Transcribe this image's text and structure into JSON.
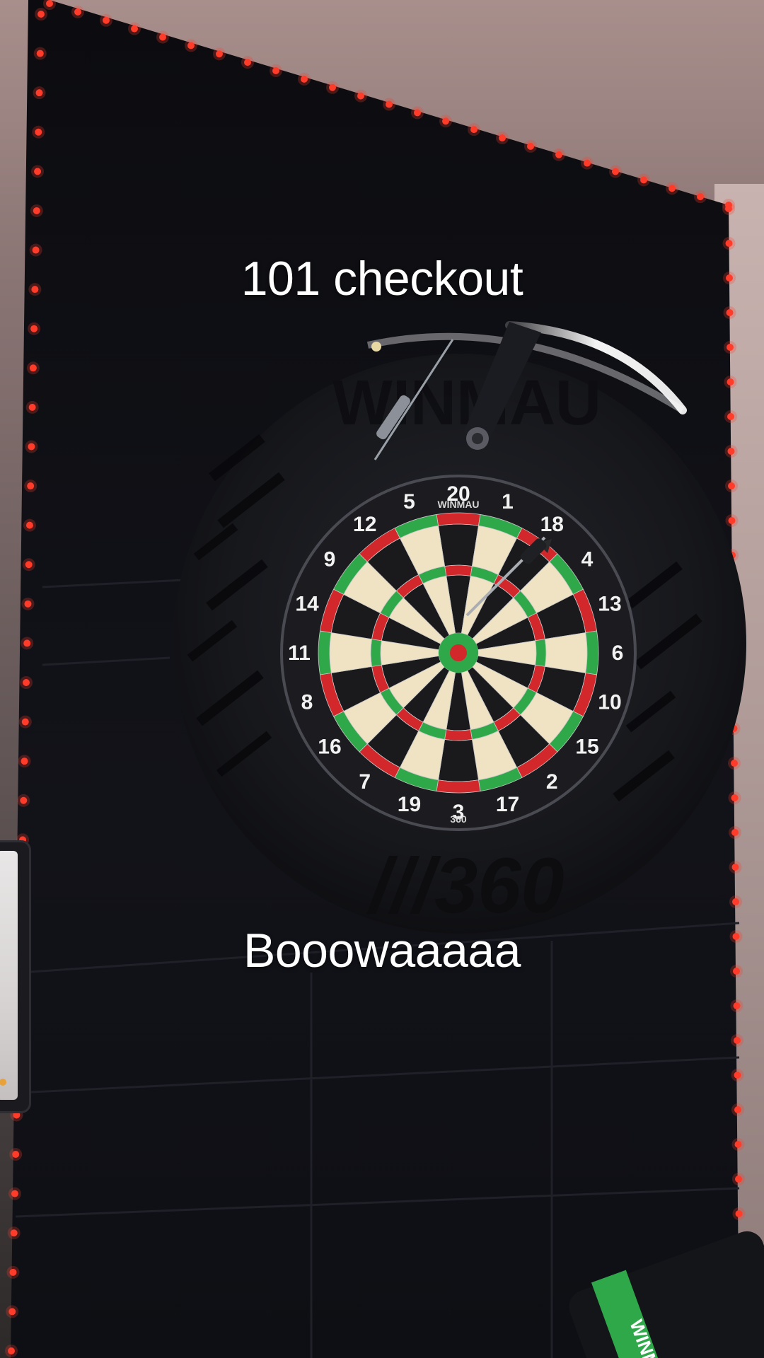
{
  "overlay": {
    "caption_top": "101 checkout",
    "caption_bottom": "Booowaaaaa"
  },
  "dartboard": {
    "brand": "WINMAU",
    "model_mark": "360",
    "numbers_clockwise_from_top": [
      20,
      1,
      18,
      4,
      13,
      6,
      10,
      15,
      2,
      17,
      3,
      19,
      7,
      16,
      8,
      11,
      14,
      9,
      12,
      5
    ],
    "colors": {
      "single_light": "#efe3c4",
      "single_dark": "#1a1a1c",
      "ring_red": "#d2282c",
      "ring_green": "#2fa84a",
      "surround": "#16171b",
      "number_ring": "#1c1c20"
    }
  },
  "colors": {
    "led_strip": "#ff3b2a",
    "panel": "#101116",
    "caption": "#ffffff"
  },
  "icons": {
    "light_bar": "led-light-bar-icon",
    "dart": "dart-icon",
    "tablet": "tablet-icon"
  }
}
